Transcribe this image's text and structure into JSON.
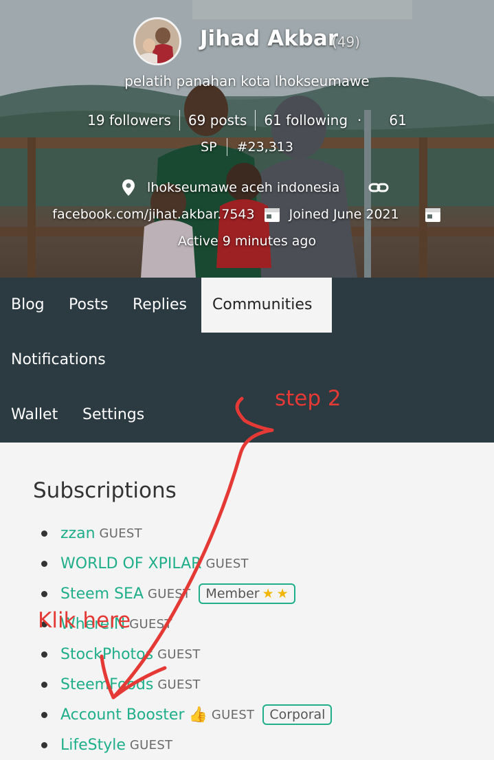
{
  "profile": {
    "name": "Jihad Akbar",
    "reputation": "(49)",
    "about": "pelatih panahan kota lhokseumawe",
    "followers": "19 followers",
    "posts": "69 posts",
    "following": "61 following",
    "sp_value": "61",
    "sp_label": "SP",
    "rank": "#23,313",
    "location": "lhokseumawe aceh indonesia",
    "website": "facebook.com/jihat.akbar.7543",
    "joined": "Joined June 2021",
    "active": "Active 9 minutes ago"
  },
  "nav": {
    "items": [
      {
        "label": "Blog"
      },
      {
        "label": "Posts"
      },
      {
        "label": "Replies"
      },
      {
        "label": "Communities"
      },
      {
        "label": "Notifications"
      },
      {
        "label": "Wallet"
      },
      {
        "label": "Settings"
      }
    ],
    "active": "Communities"
  },
  "subscriptions": {
    "title": "Subscriptions",
    "items": [
      {
        "name": "zzan",
        "role": "GUEST"
      },
      {
        "name": "WORLD OF XPILAR",
        "role": "GUEST"
      },
      {
        "name": "Steem SEA",
        "role": "GUEST",
        "badge": "Member"
      },
      {
        "name": "WhereIN",
        "role": "GUEST"
      },
      {
        "name": "StockPhotos",
        "role": "GUEST"
      },
      {
        "name": "SteemFoods",
        "role": "GUEST"
      },
      {
        "name": "Account Booster",
        "role": "GUEST",
        "badge": "Corporal",
        "emoji": "👍"
      },
      {
        "name": "LifeStyle",
        "role": "GUEST"
      }
    ]
  },
  "annotations": {
    "step": "step 2",
    "click": "Klik here"
  },
  "colors": {
    "nav_bg": "#2c3a41",
    "community_link": "#1fae8a",
    "annotation": "#e53935"
  }
}
